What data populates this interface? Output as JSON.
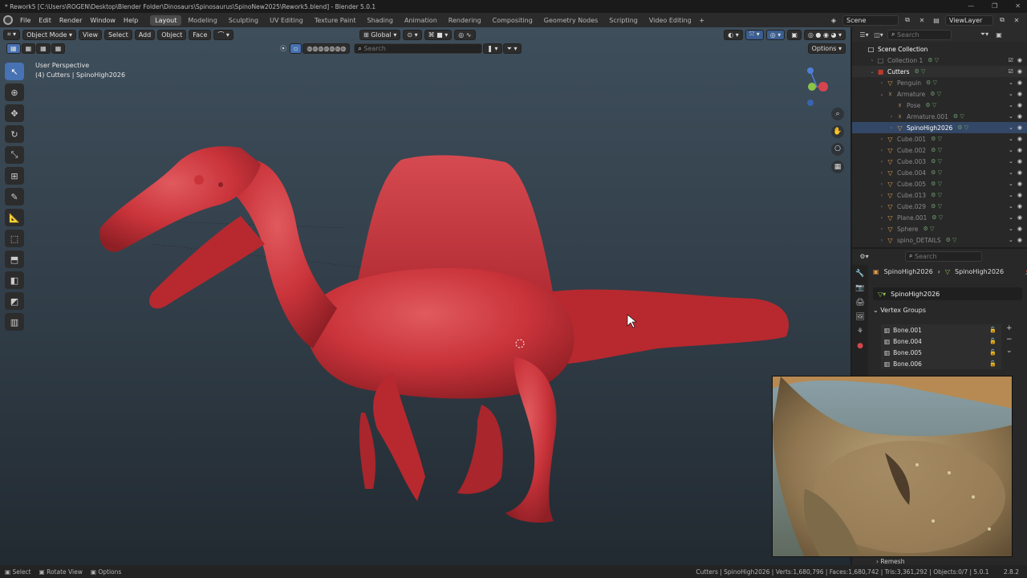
{
  "window": {
    "title": "* Rework5 [C:\\Users\\ROGEN\\Desktop\\Blender Folder\\Dinosaurs\\Spinosaurus\\SpinoNew2025\\Rework5.blend] - Blender 5.0.1"
  },
  "menu": [
    "File",
    "Edit",
    "Render",
    "Window",
    "Help"
  ],
  "workspaces": [
    "Layout",
    "Modeling",
    "Sculpting",
    "UV Editing",
    "Texture Paint",
    "Shading",
    "Animation",
    "Rendering",
    "Compositing",
    "Geometry Nodes",
    "Scripting",
    "Video Editing"
  ],
  "active_workspace": "Layout",
  "top_right": {
    "scene": "Scene",
    "view_layer": "ViewLayer"
  },
  "viewport": {
    "mode": "Object Mode",
    "menus": [
      "View",
      "Select",
      "Add",
      "Object",
      "Face"
    ],
    "orientation": "Global",
    "search_placeholder": "Search",
    "options_label": "Options",
    "perspective_label": "User Perspective",
    "object_label": "(4) Cutters | SpinoHigh2026"
  },
  "outliner": {
    "search_placeholder": "Search",
    "rows": [
      {
        "label": "Scene Collection",
        "icon": "□",
        "tri": "",
        "indent": 0,
        "style": "sel"
      },
      {
        "label": "Collection 1",
        "icon": "□",
        "tri": "›",
        "indent": 1,
        "style": "dim"
      },
      {
        "label": "Cutters",
        "icon": "■",
        "tri": "⌄",
        "indent": 1,
        "style": "sel"
      },
      {
        "label": "Penguin",
        "icon": "▽",
        "tri": "›",
        "indent": 2,
        "style": "dim"
      },
      {
        "label": "Armature",
        "icon": "☓",
        "tri": "⌄",
        "indent": 2,
        "style": "dim"
      },
      {
        "label": "Pose",
        "icon": "☓",
        "tri": "",
        "indent": 3,
        "style": "dim"
      },
      {
        "label": "Armature.001",
        "icon": "☓",
        "tri": "›",
        "indent": 3,
        "style": "dim"
      },
      {
        "label": "SpinoHigh2026",
        "icon": "▽",
        "tri": "›",
        "indent": 3,
        "style": "sel"
      },
      {
        "label": "Cube.001",
        "icon": "▽",
        "tri": "›",
        "indent": 2,
        "style": "dim"
      },
      {
        "label": "Cube.002",
        "icon": "▽",
        "tri": "›",
        "indent": 2,
        "style": "dim"
      },
      {
        "label": "Cube.003",
        "icon": "▽",
        "tri": "›",
        "indent": 2,
        "style": "dim"
      },
      {
        "label": "Cube.004",
        "icon": "▽",
        "tri": "›",
        "indent": 2,
        "style": "dim"
      },
      {
        "label": "Cube.005",
        "icon": "▽",
        "tri": "›",
        "indent": 2,
        "style": "dim"
      },
      {
        "label": "Cube.013",
        "icon": "▽",
        "tri": "›",
        "indent": 2,
        "style": "dim"
      },
      {
        "label": "Cube.029",
        "icon": "▽",
        "tri": "›",
        "indent": 2,
        "style": "dim"
      },
      {
        "label": "Plane.001",
        "icon": "▽",
        "tri": "›",
        "indent": 2,
        "style": "dim"
      },
      {
        "label": "Sphere",
        "icon": "▽",
        "tri": "›",
        "indent": 2,
        "style": "dim"
      },
      {
        "label": "spino_DETAILS",
        "icon": "▽",
        "tri": "›",
        "indent": 2,
        "style": "dim"
      }
    ]
  },
  "properties": {
    "search_placeholder": "Search",
    "breadcrumb_object": "SpinoHigh2026",
    "breadcrumb_mesh": "SpinoHigh2026",
    "mesh_name": "SpinoHigh2026",
    "panel_title": "Vertex Groups",
    "vertex_groups": [
      "Bone.001",
      "Bone.004",
      "Bone.005",
      "Bone.006"
    ],
    "collapsed_panel": "Remesh"
  },
  "statusbar": {
    "select": "Select",
    "rotate": "Rotate View",
    "options": "Options",
    "stats": "Cutters | SpinoHigh2026 | Verts:1,680,796 | Faces:1,680,742 | Tris:3,361,292 | Objects:0/7 | 5.0.1",
    "fps": "2.8.2"
  },
  "colors": {
    "model_red": "#c9333a",
    "accent_blue": "#4772b3",
    "cutters_red": "#c0392b"
  }
}
